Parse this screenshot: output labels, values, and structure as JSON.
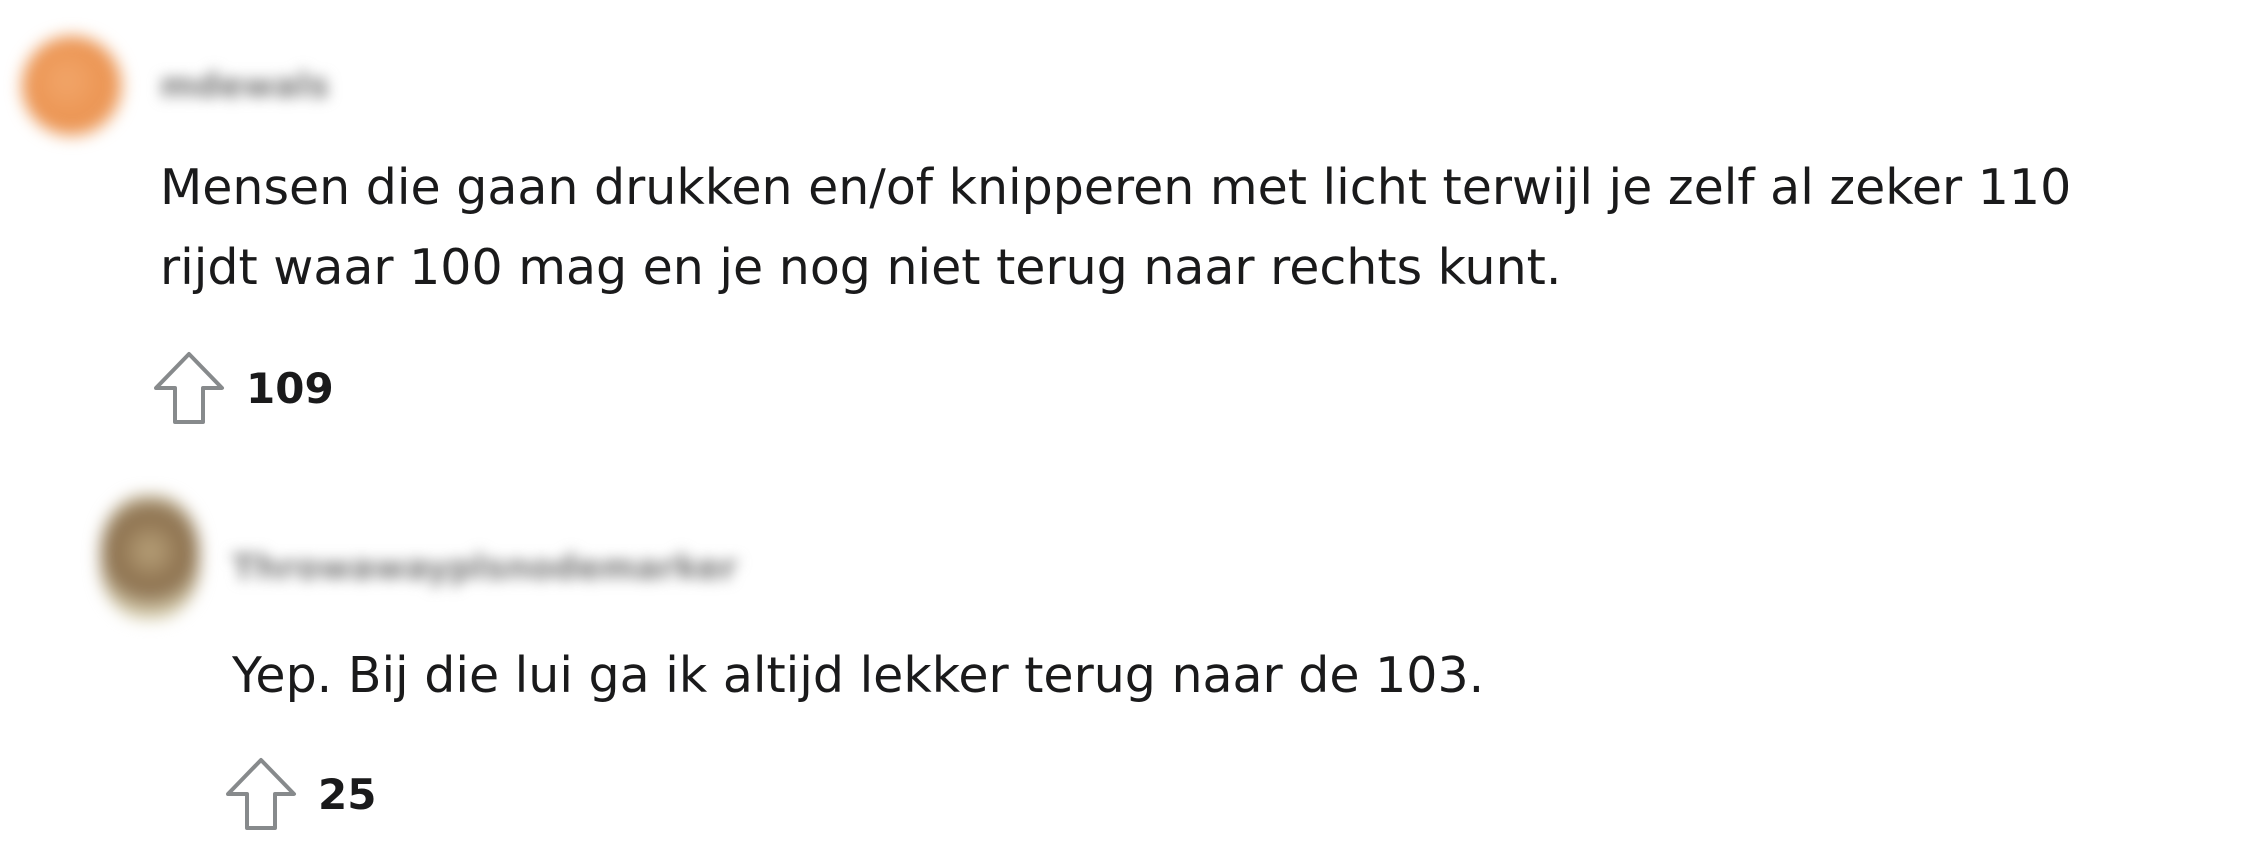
{
  "comments": [
    {
      "username": "mdewals",
      "body": "Mensen die gaan drukken en/of knipperen met licht terwijl je zelf al zeker 110",
      "body_line2": "rijdt waar 100 mag en je nog niet terug naar rechts kunt.",
      "upvotes": "109",
      "icon": "upvote-arrow-icon"
    },
    {
      "username": "Throwawayplsnodemarker",
      "body": "Yep. Bij die lui ga ik altijd lekker terug naar de 103.",
      "upvotes": "25",
      "icon": "upvote-arrow-icon"
    }
  ],
  "colors": {
    "text": "#1a1a1b",
    "icon_stroke": "#878a8c",
    "avatar_1": "#eb9452",
    "avatar_2": "#8a6e4c"
  }
}
